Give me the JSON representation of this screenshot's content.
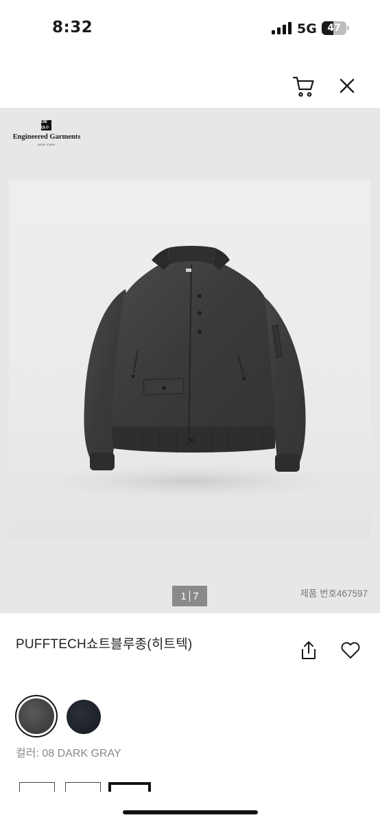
{
  "status_bar": {
    "time": "8:32",
    "network": "5G",
    "battery": "47",
    "battery_level": 0.47
  },
  "header": {
    "icons": [
      "cart-icon",
      "close-icon"
    ]
  },
  "gallery": {
    "brand": {
      "logo_letters": [
        "UNI",
        "QLO"
      ],
      "name": "Engineered Garments",
      "sub": "NEW YORK"
    },
    "image_alt_icon": "jacket-photo",
    "pager_current": "1",
    "pager_total": "7",
    "product_number": "제품 번호467597"
  },
  "product": {
    "title": "PUFFTECH쇼트블루종(히트텍)",
    "icons": [
      "share-icon",
      "heart-icon"
    ],
    "colors": [
      {
        "name": "08 DARK GRAY",
        "hex": "#474747",
        "selected": true
      },
      {
        "name": "navy",
        "hex": "#1e222a",
        "selected": false
      }
    ],
    "color_label": "컬러: 08 DARK GRAY"
  },
  "accent_colors": {
    "pager_bg": "#8a8a8c",
    "image_bg": "#e7e7e9"
  }
}
